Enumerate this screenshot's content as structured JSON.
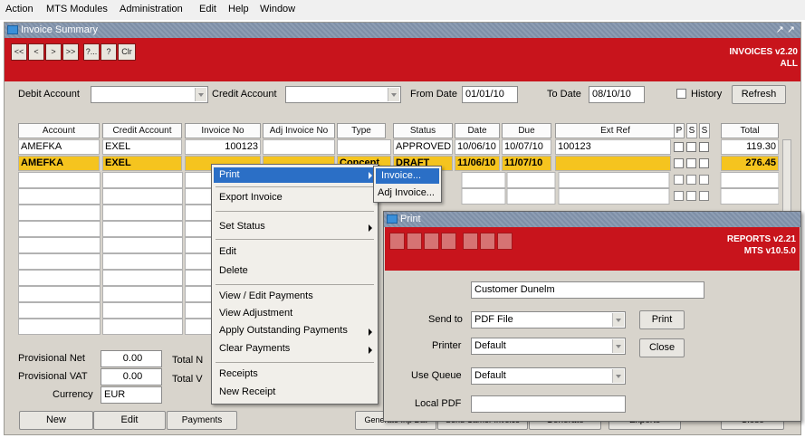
{
  "menubar": {
    "items": [
      "Action",
      "MTS Modules",
      "Administration",
      "Edit",
      "Help",
      "Window"
    ]
  },
  "window": {
    "title": "Invoice Summary",
    "controls": "↗ ↗",
    "app_title_line1": "INVOICES v2.20",
    "app_title_line2": "ALL",
    "toolbar": [
      "<<",
      "<",
      ">",
      ">>",
      "?...",
      "?",
      "Clr"
    ]
  },
  "filters": {
    "debit_account_label": "Debit Account",
    "debit_account_value": "",
    "credit_account_label": "Credit Account",
    "credit_account_value": "",
    "from_date_label": "From Date",
    "from_date_value": "01/01/10",
    "to_date_label": "To Date",
    "to_date_value": "08/10/10",
    "history_label": "History",
    "refresh_label": "Refresh"
  },
  "grid": {
    "headers": [
      "Account",
      "Credit Account",
      "Invoice No",
      "Adj Invoice No",
      "Type",
      "Status",
      "Date",
      "Due",
      "Ext Ref",
      "P",
      "S",
      "S",
      "Total"
    ],
    "rows": [
      {
        "account": "AMEFKA",
        "credit_account": "EXEL",
        "invoice_no": "100123",
        "adj_invoice_no": "",
        "type": "",
        "status": "APPROVED",
        "date": "10/06/10",
        "due": "10/07/10",
        "ext_ref": "100123",
        "total": "119.30"
      },
      {
        "account": "AMEFKA",
        "credit_account": "EXEL",
        "invoice_no": "",
        "adj_invoice_no": "",
        "type": "Concept",
        "status": "DRAFT",
        "date": "11/06/10",
        "due": "11/07/10",
        "ext_ref": "",
        "total": "276.45"
      }
    ]
  },
  "totals": {
    "provisional_net_label": "Provisional Net",
    "provisional_net_value": "0.00",
    "provisional_vat_label": "Provisional VAT",
    "provisional_vat_value": "0.00",
    "currency_label": "Currency",
    "currency_value": "EUR",
    "total_net_label": "Total N",
    "total_vat_label": "Total V"
  },
  "bottom_buttons": [
    "New",
    "Edit",
    "Payments",
    "Generate Inp Dat",
    "Send Carrier Invoice",
    "Generate",
    "Exports",
    "Close"
  ],
  "context_menu": {
    "items": [
      "Print",
      "Export Invoice",
      "Set Status",
      "Edit",
      "Delete",
      "View / Edit Payments",
      "View Adjustment",
      "Apply Outstanding Payments",
      "Clear Payments",
      "Receipts",
      "New Receipt"
    ]
  },
  "print_submenu": {
    "items": [
      "Invoice...",
      "Adj Invoice..."
    ]
  },
  "print_dialog": {
    "title": "Print",
    "app_title_line1": "REPORTS v2.21",
    "app_title_line2": "MTS v10.5.0",
    "customer": "Customer Dunelm",
    "send_to_label": "Send to",
    "send_to_value": "PDF File",
    "printer_label": "Printer",
    "printer_value": "Default",
    "use_queue_label": "Use Queue",
    "use_queue_value": "Default",
    "local_pdf_label": "Local PDF",
    "local_pdf_value": "",
    "print_label": "Print",
    "close_label": "Close"
  },
  "colors": {
    "toolbar_red": "#c8141c",
    "selected_row": "#f5c41f",
    "menu_highlight": "#2b6fc6"
  }
}
